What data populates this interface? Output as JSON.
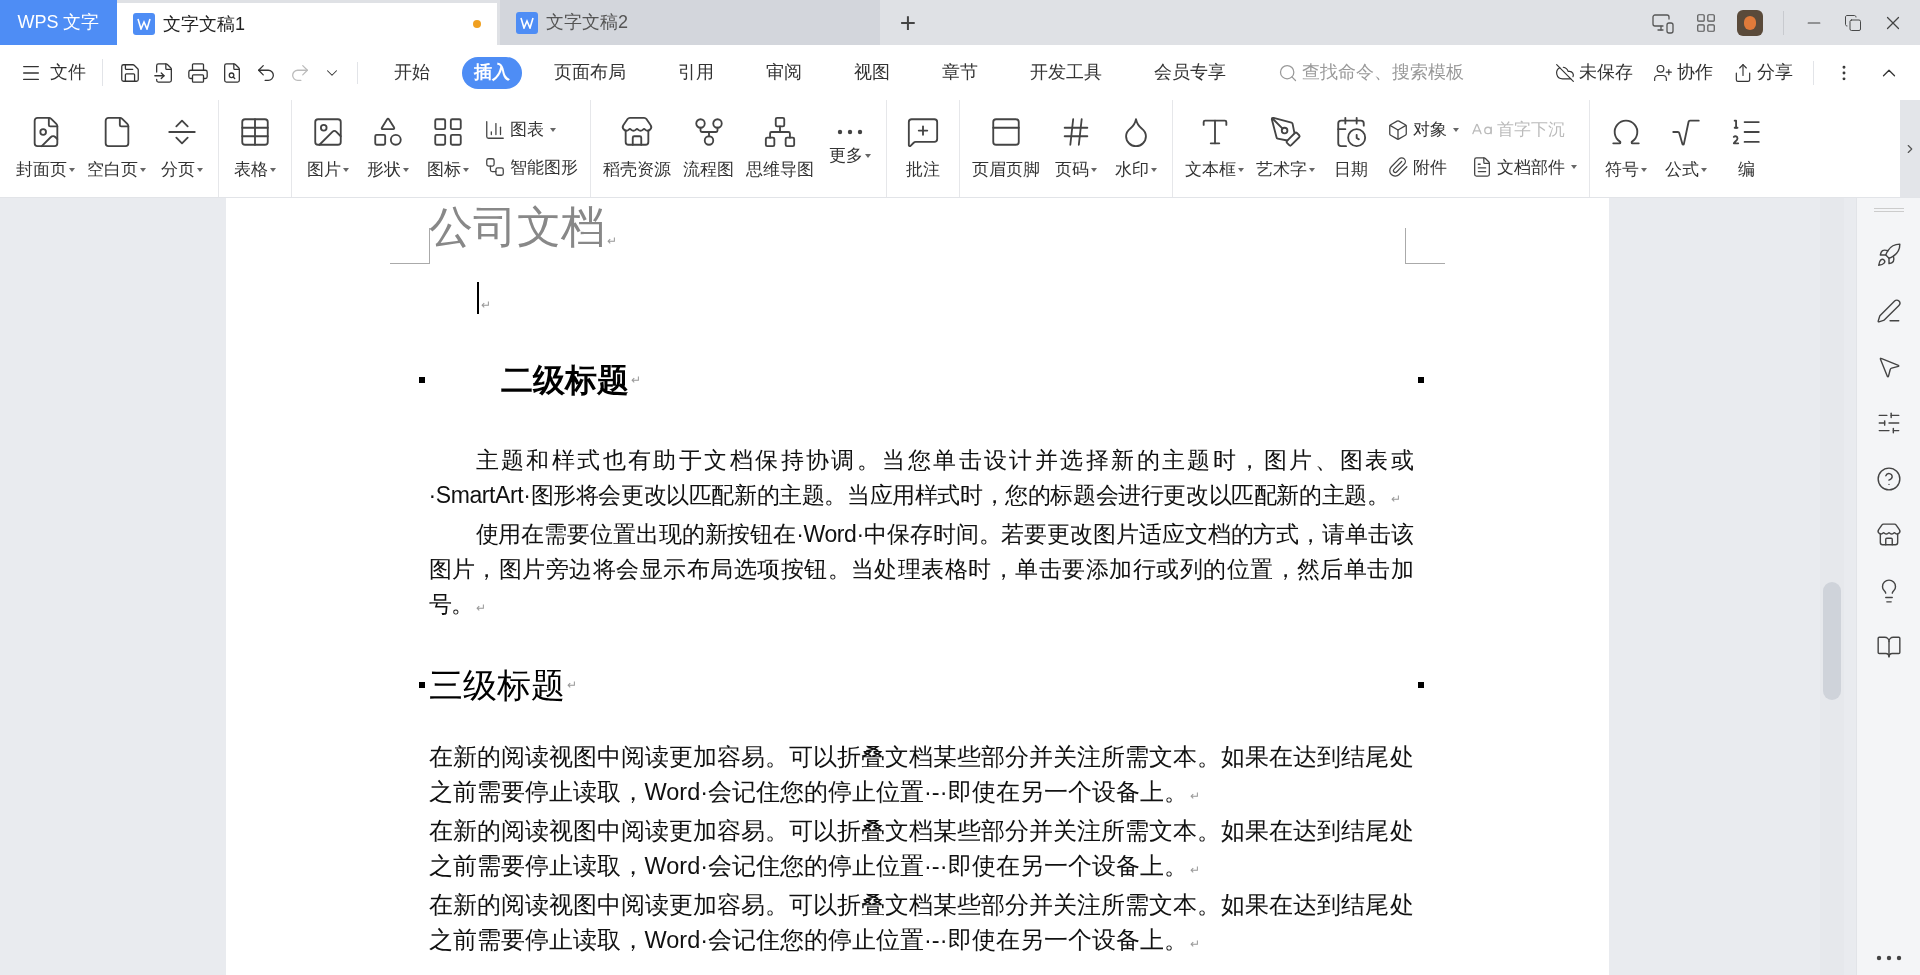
{
  "title_bar": {
    "app_tab": "WPS 文字",
    "doc_tabs": [
      {
        "title": "文字文稿1",
        "selected": true,
        "unsaved": true
      },
      {
        "title": "文字文稿2",
        "selected": false,
        "unsaved": false
      }
    ],
    "new_tab": "+"
  },
  "menu": {
    "file": "文件",
    "tabs": [
      {
        "label": "开始",
        "selected": false
      },
      {
        "label": "插入",
        "selected": true
      },
      {
        "label": "页面布局",
        "selected": false
      },
      {
        "label": "引用",
        "selected": false
      },
      {
        "label": "审阅",
        "selected": false
      },
      {
        "label": "视图",
        "selected": false
      },
      {
        "label": "章节",
        "selected": false
      },
      {
        "label": "开发工具",
        "selected": false
      },
      {
        "label": "会员专享",
        "selected": false
      }
    ],
    "search": {
      "placeholder": "查找命令、搜索模板"
    },
    "actions": [
      "未保存",
      "协作",
      "分享"
    ]
  },
  "ribbon": {
    "groups": [
      {
        "items": [
          {
            "kind": "large",
            "label": "封面页",
            "dropdown": true
          },
          {
            "kind": "large",
            "label": "空白页",
            "dropdown": true
          },
          {
            "kind": "large",
            "label": "分页",
            "dropdown": true
          }
        ]
      },
      {
        "items": [
          {
            "kind": "large",
            "label": "表格",
            "dropdown": true
          }
        ]
      },
      {
        "items": [
          {
            "kind": "large",
            "label": "图片",
            "dropdown": true
          },
          {
            "kind": "large",
            "label": "形状",
            "dropdown": true
          },
          {
            "kind": "large",
            "label": "图标",
            "dropdown": true
          },
          {
            "kind": "stack",
            "entries": [
              {
                "label": "图表",
                "dropdown": true,
                "disabled": false
              },
              {
                "label": "智能图形",
                "dropdown": false,
                "disabled": false
              }
            ]
          }
        ]
      },
      {
        "items": [
          {
            "kind": "large",
            "label": "稻壳资源",
            "dropdown": false
          },
          {
            "kind": "large",
            "label": "流程图",
            "dropdown": false
          },
          {
            "kind": "large",
            "label": "思维导图",
            "dropdown": false
          },
          {
            "kind": "large",
            "label": "更多",
            "dropdown": true
          }
        ]
      },
      {
        "items": [
          {
            "kind": "large",
            "label": "批注",
            "dropdown": false
          }
        ]
      },
      {
        "items": [
          {
            "kind": "large",
            "label": "页眉页脚",
            "dropdown": false
          },
          {
            "kind": "large",
            "label": "页码",
            "dropdown": true
          },
          {
            "kind": "large",
            "label": "水印",
            "dropdown": true
          }
        ]
      },
      {
        "items": [
          {
            "kind": "large",
            "label": "文本框",
            "dropdown": true
          },
          {
            "kind": "large",
            "label": "艺术字",
            "dropdown": true
          },
          {
            "kind": "large",
            "label": "日期",
            "dropdown": false
          },
          {
            "kind": "stack",
            "entries": [
              {
                "label": "对象",
                "dropdown": true,
                "disabled": false
              },
              {
                "label": "附件",
                "dropdown": false,
                "disabled": false
              }
            ]
          },
          {
            "kind": "stack",
            "entries": [
              {
                "label": "首字下沉",
                "dropdown": false,
                "disabled": true
              },
              {
                "label": "文档部件",
                "dropdown": true,
                "disabled": false
              }
            ]
          }
        ]
      },
      {
        "items": [
          {
            "kind": "large",
            "label": "符号",
            "dropdown": true
          },
          {
            "kind": "large",
            "label": "公式",
            "dropdown": true
          },
          {
            "kind": "large",
            "label": "编",
            "dropdown": false
          }
        ]
      }
    ]
  },
  "document": {
    "blocks": [
      {
        "kind": "title",
        "text": "公司文档",
        "end_mark": "↵"
      },
      {
        "kind": "cursor",
        "end_mark": "↵"
      },
      {
        "kind": "heading2",
        "text": "二级标题",
        "end_mark": "↵"
      },
      {
        "kind": "indented",
        "text": "主题和样式也有助于文档保持协调。当您单击设计并选择新的主题时，图片、图表或·SmartArt·图形将会更改以匹配新的主题。当应用样式时，您的标题会进行更改以匹配新的主题。",
        "end_mark": "↵"
      },
      {
        "kind": "indented",
        "text": "使用在需要位置出现的新按钮在·Word·中保存时间。若要更改图片适应文档的方式，请单击该图片，图片旁边将会显示布局选项按钮。当处理表格时，单击要添加行或列的位置，然后单击加号。",
        "end_mark": "↵"
      },
      {
        "kind": "heading3",
        "text": "三级标题",
        "end_mark": "↵"
      },
      {
        "kind": "plain",
        "text": "在新的阅读视图中阅读更加容易。可以折叠文档某些部分并关注所需文本。如果在达到结尾处之前需要停止读取，Word·会记住您的停止位置·-·即使在另一个设备上。",
        "end_mark": "↵"
      },
      {
        "kind": "plain",
        "text": "在新的阅读视图中阅读更加容易。可以折叠文档某些部分并关注所需文本。如果在达到结尾处之前需要停止读取，Word·会记住您的停止位置·-·即使在另一个设备上。",
        "end_mark": "↵"
      },
      {
        "kind": "plain",
        "text": "在新的阅读视图中阅读更加容易。可以折叠文档某些部分并关注所需文本。如果在达到结尾处之前需要停止读取，Word·会记住您的停止位置·-·即使在另一个设备上。",
        "end_mark": "↵"
      }
    ]
  }
}
